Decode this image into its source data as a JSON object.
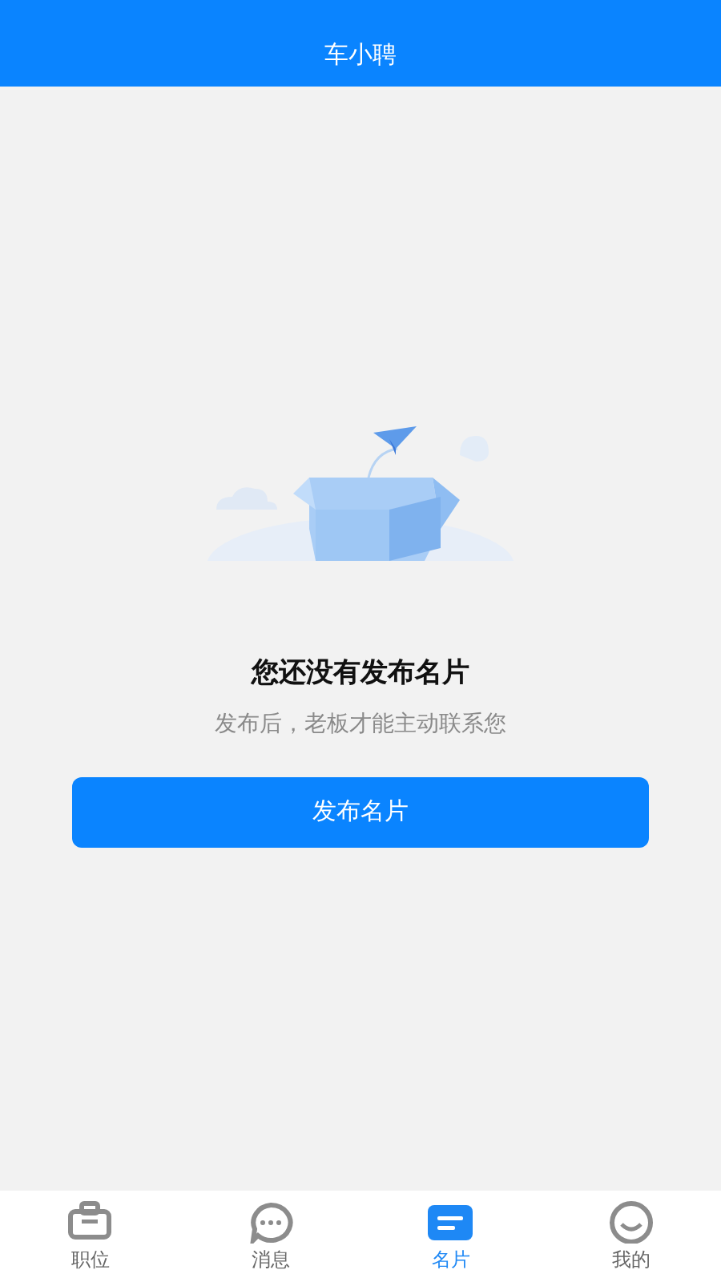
{
  "header": {
    "title": "车小聘"
  },
  "empty_state": {
    "title": "您还没有发布名片",
    "message": "发布后，老板才能主动联系您",
    "button": "发布名片"
  },
  "tab_bar": [
    {
      "kind": "briefcase",
      "label": "职位",
      "selected": false
    },
    {
      "kind": "chat",
      "label": "消息",
      "selected": false
    },
    {
      "kind": "card",
      "label": "名片",
      "selected": true
    },
    {
      "kind": "smile",
      "label": "我的",
      "selected": false
    }
  ]
}
